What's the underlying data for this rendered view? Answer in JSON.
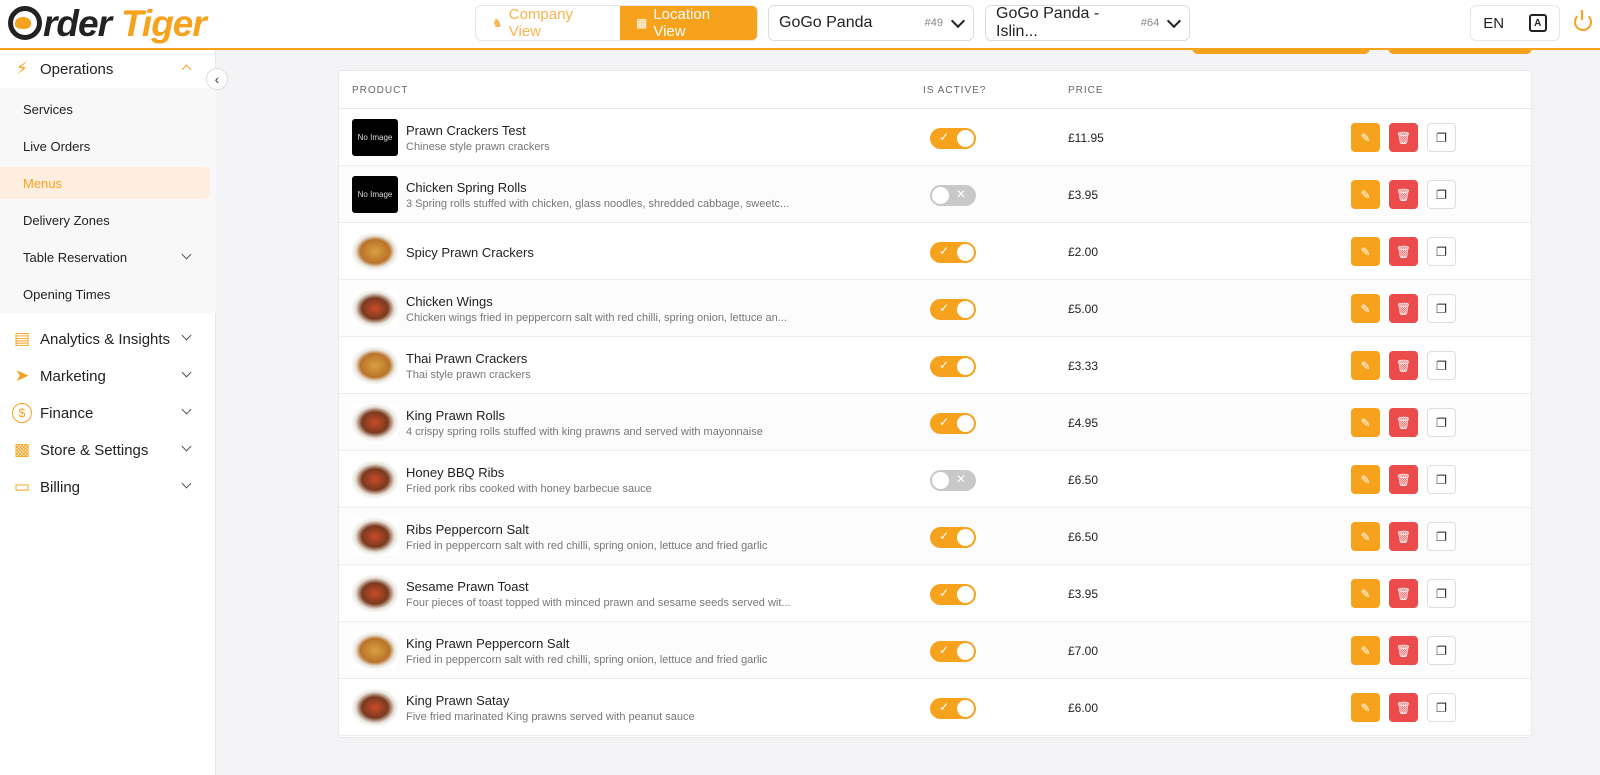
{
  "header": {
    "logo_first": "rder",
    "logo_second": "Tiger",
    "company_view": "Company View",
    "location_view": "Location View",
    "select1": {
      "value": "GoGo Panda",
      "id": "#49"
    },
    "select2": {
      "value": "GoGo Panda - Islin...",
      "id": "#64"
    },
    "language": "EN"
  },
  "sidebar": {
    "operations": "Operations",
    "sub_items": [
      "Services",
      "Live Orders",
      "Menus",
      "Delivery Zones",
      "Table Reservation",
      "Opening Times"
    ],
    "analytics": "Analytics & Insights",
    "marketing": "Marketing",
    "finance": "Finance",
    "store": "Store & Settings",
    "billing": "Billing"
  },
  "table": {
    "headers": {
      "product": "PRODUCT",
      "active": "IS ACTIVE?",
      "price": "PRICE"
    },
    "no_image": "No Image",
    "rows": [
      {
        "name": "Prawn Crackers Test",
        "desc": "Chinese style prawn crackers",
        "active": true,
        "price": "£11.95"
      },
      {
        "name": "Chicken Spring Rolls",
        "desc": "3 Spring rolls stuffed with chicken, glass noodles, shredded cabbage, sweetc...",
        "active": false,
        "price": "£3.95"
      },
      {
        "name": "Spicy Prawn Crackers",
        "desc": "",
        "active": true,
        "price": "£2.00"
      },
      {
        "name": "Chicken Wings",
        "desc": "Chicken wings fried in peppercorn salt with red chilli, spring onion, lettuce an...",
        "active": true,
        "price": "£5.00"
      },
      {
        "name": "Thai Prawn Crackers",
        "desc": "Thai style prawn crackers",
        "active": true,
        "price": "£3.33"
      },
      {
        "name": "King Prawn Rolls",
        "desc": "4 crispy spring rolls stuffed with king prawns and served with mayonnaise",
        "active": true,
        "price": "£4.95"
      },
      {
        "name": "Honey BBQ Ribs",
        "desc": "Fried pork ribs cooked with honey barbecue sauce",
        "active": false,
        "price": "£6.50"
      },
      {
        "name": "Ribs Peppercorn Salt",
        "desc": "Fried in peppercorn salt with red chilli, spring onion, lettuce and fried garlic",
        "active": true,
        "price": "£6.50"
      },
      {
        "name": "Sesame Prawn Toast",
        "desc": "Four pieces of toast topped with minced prawn and sesame seeds served wit...",
        "active": true,
        "price": "£3.95"
      },
      {
        "name": "King Prawn Peppercorn Salt",
        "desc": "Fried in peppercorn salt with red chilli, spring onion, lettuce and fried garlic",
        "active": true,
        "price": "£7.00"
      },
      {
        "name": "King Prawn Satay",
        "desc": "Five fried marinated King prawns served with peanut sauce",
        "active": true,
        "price": "£6.00"
      }
    ]
  },
  "colors": {
    "accent": "#f7a21c",
    "danger": "#ec4b4b"
  }
}
